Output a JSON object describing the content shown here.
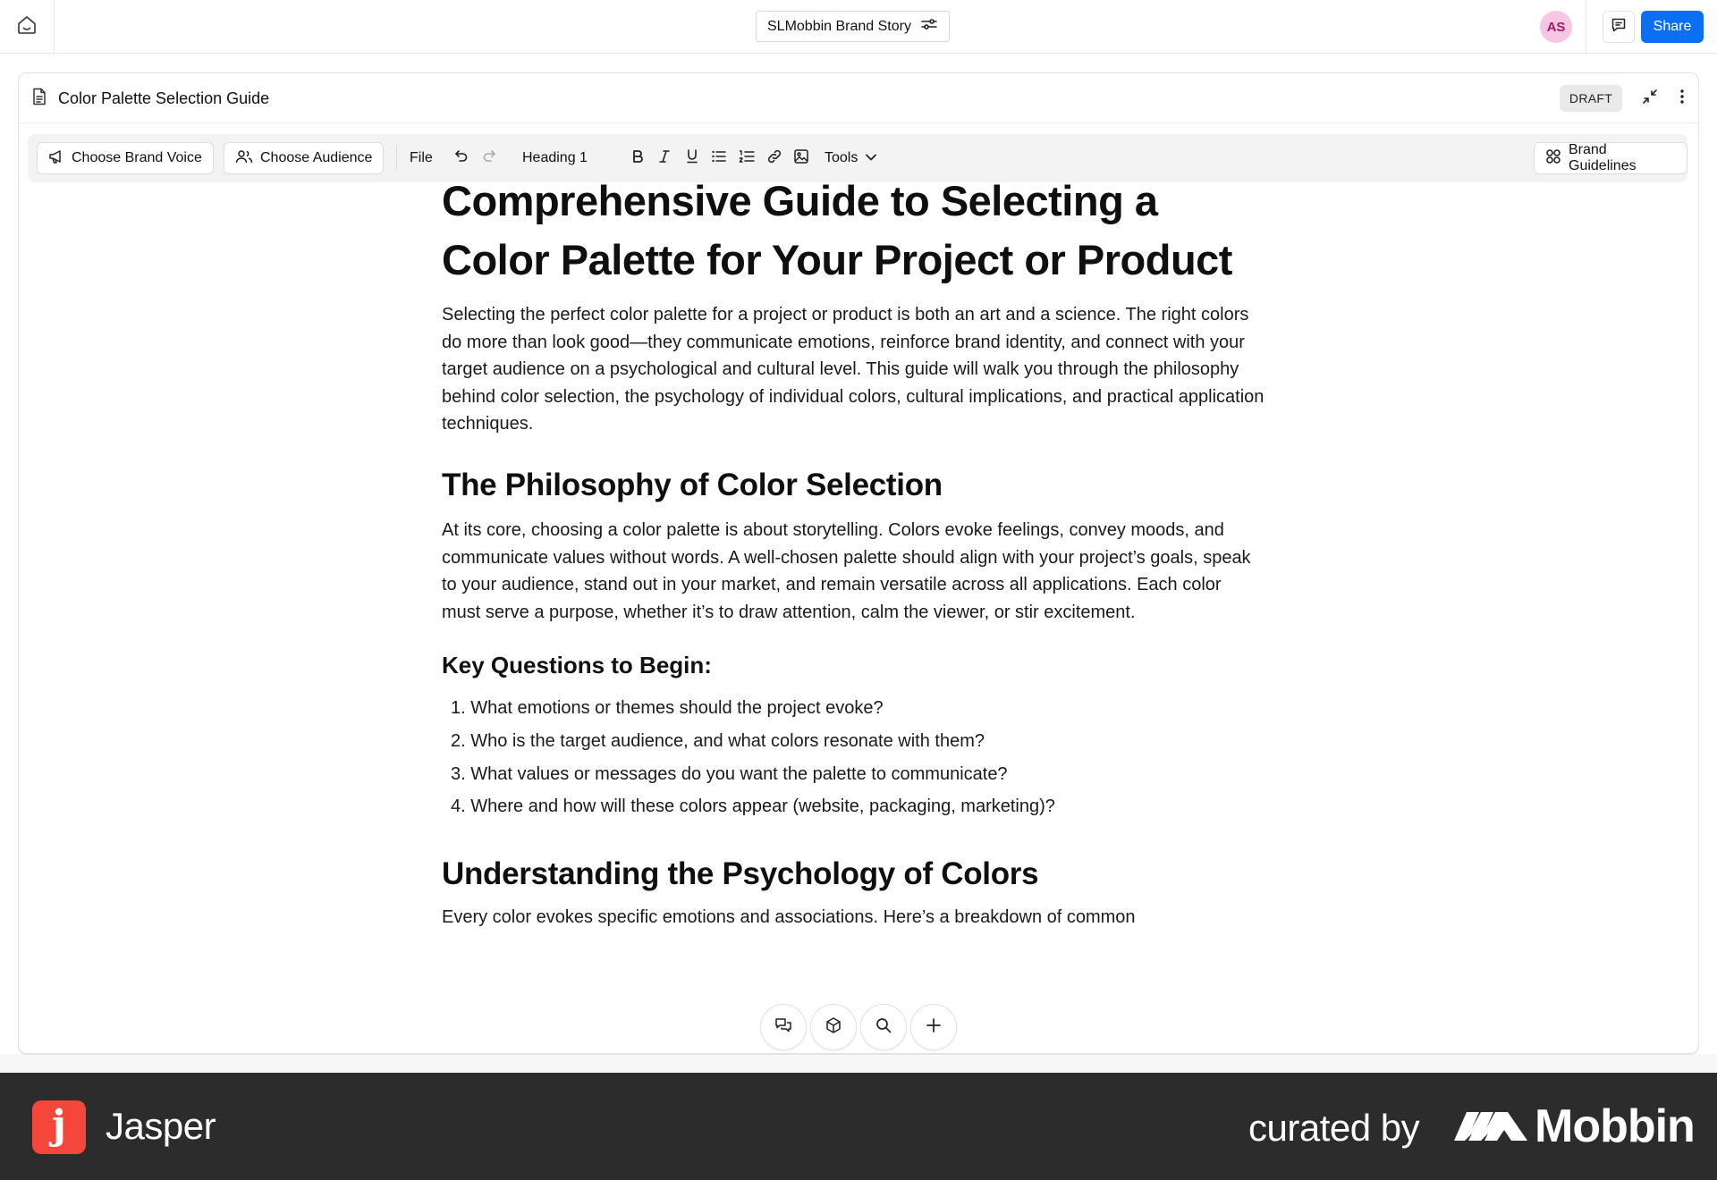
{
  "topbar": {
    "doc_chip_label": "SLMobbin Brand Story",
    "avatar_initials": "AS",
    "share_label": "Share"
  },
  "panel": {
    "title": "Color Palette Selection Guide",
    "status_badge": "DRAFT"
  },
  "toolbar": {
    "brand_voice_label": "Choose Brand Voice",
    "audience_label": "Choose Audience",
    "file_label": "File",
    "heading_label": "Heading 1",
    "tools_label": "Tools",
    "brand_guidelines_label": "Brand Guidelines"
  },
  "article": {
    "title": "Comprehensive Guide to Selecting a Color Palette for Your Project or Product",
    "intro": "Selecting the perfect color palette for a project or product is both an art and a science. The right colors do more than look good—they communicate emotions, reinforce brand identity, and connect with your target audience on a psychological and cultural level. This guide will walk you through the philosophy behind color selection, the psychology of individual colors, cultural implications, and practical application techniques.",
    "section1_heading": "The Philosophy of Color Selection",
    "section1_body": "At its core, choosing a color palette is about storytelling. Colors evoke feelings, convey moods, and communicate values without words. A well-chosen palette should align with your project’s goals, speak to your audience, stand out in your market, and remain versatile across all applications. Each color must serve a purpose, whether it’s to draw attention, calm the viewer, or stir excitement.",
    "questions_heading": "Key Questions to Begin:",
    "questions": [
      "1. What emotions or themes should the project evoke?",
      "2. Who is the target audience, and what colors resonate with them?",
      "3. What values or messages do you want the palette to communicate?",
      "4. Where and how will these colors appear (website, packaging, marketing)?"
    ],
    "section2_heading": "Understanding the Psychology of Colors",
    "section2_body": "Every color evokes specific emotions and associations. Here’s a breakdown of common"
  },
  "floating_bar": {
    "icons": [
      "chat-icon",
      "cube-icon",
      "search-icon",
      "plus-icon"
    ]
  },
  "footer": {
    "app_name": "Jasper",
    "app_logo_letter": "j",
    "curated_label": "curated by",
    "curator_name": "Mobbin"
  },
  "colors": {
    "accent": "#0a6ff2",
    "avatar_bg": "#f6c7e4",
    "jasper_red": "#f4463a",
    "footer_bg": "#2c2c2c"
  }
}
